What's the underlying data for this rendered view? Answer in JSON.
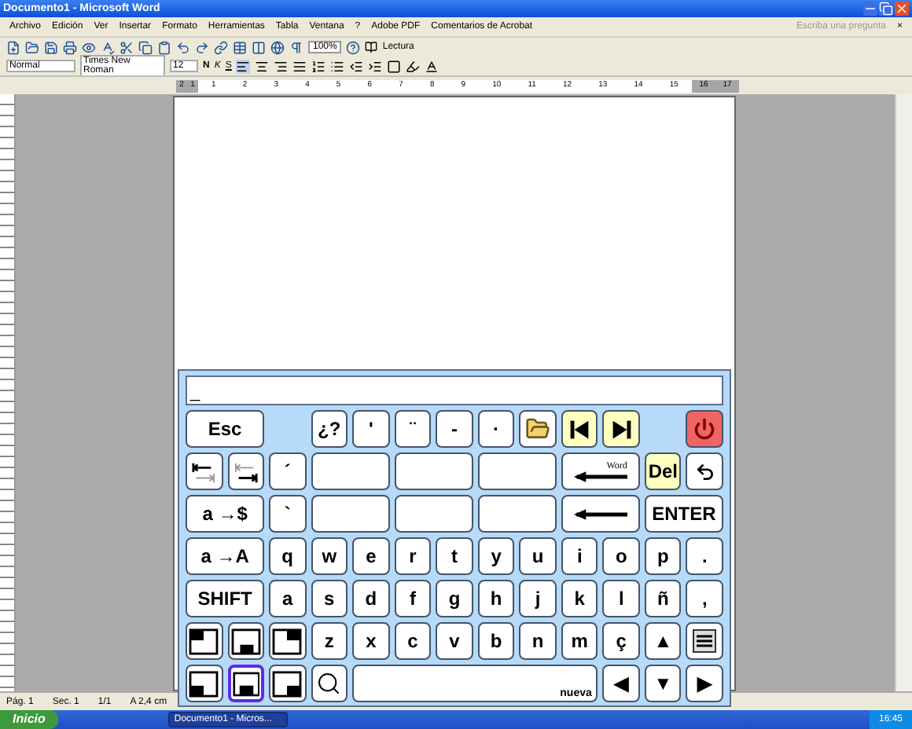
{
  "window": {
    "title": "Documento1 - Microsoft Word"
  },
  "menu": {
    "items": [
      "Archivo",
      "Edición",
      "Ver",
      "Insertar",
      "Formato",
      "Herramientas",
      "Tabla",
      "Ventana",
      "?",
      "Adobe PDF",
      "Comentarios de Acrobat"
    ],
    "help_placeholder": "Escriba una pregunta",
    "close": "×"
  },
  "toolbar": {
    "zoom": "100%",
    "reading": "Lectura"
  },
  "format_bar": {
    "style": "Normal",
    "font": "Times New Roman",
    "size": "12",
    "bold": "N",
    "italic": "K",
    "underline": "S"
  },
  "ruler": {
    "left_numbers": [
      "2",
      "1"
    ],
    "numbers": [
      "1",
      "2",
      "3",
      "4",
      "5",
      "6",
      "7",
      "8",
      "9",
      "10",
      "11",
      "12",
      "13",
      "14",
      "15"
    ],
    "right_numbers": [
      "16",
      "17"
    ]
  },
  "status_bar": [
    "Pág. 1",
    "Sec. 1",
    "1/1",
    "A 2,4 cm"
  ],
  "taskbar": {
    "start": "Inicio",
    "task": "Documento1 - Micros...",
    "clock": "16:45"
  },
  "keyboard": {
    "input": "_",
    "rows": [
      {
        "keys": [
          {
            "kind": "text",
            "label": "Esc",
            "color": "#ffffff",
            "selected": false
          },
          {
            "kind": "gap"
          },
          {
            "kind": "text",
            "label": "¿?",
            "color": "#ffffff",
            "selected": false
          },
          {
            "kind": "text",
            "label": "'",
            "color": "#ffffff",
            "selected": false
          },
          {
            "kind": "text",
            "label": "¨",
            "color": "#ffffff",
            "selected": false
          },
          {
            "kind": "text",
            "label": "-",
            "color": "#ffffff",
            "selected": false
          },
          {
            "kind": "text",
            "label": "·",
            "color": "#ffffff",
            "selected": false
          },
          {
            "kind": "open",
            "color": "#ffffff",
            "selected": false
          },
          {
            "kind": "first",
            "color": "#ffffc0",
            "selected": false
          },
          {
            "kind": "last",
            "color": "#ffffc0",
            "selected": false
          },
          {
            "kind": "gap"
          },
          {
            "kind": "power",
            "color": "#f06464",
            "selected": false
          }
        ]
      },
      {
        "keys": [
          {
            "kind": "tab-back",
            "color": "#ffffff",
            "selected": false
          },
          {
            "kind": "tab-fwd",
            "color": "#ffffff",
            "selected": false
          },
          {
            "kind": "text",
            "label": "´",
            "color": "#ffffff",
            "selected": false
          },
          {
            "kind": "blank",
            "color": "#ffffff",
            "selected": false
          },
          {
            "kind": "blank",
            "color": "#ffffff",
            "selected": false
          },
          {
            "kind": "blank",
            "color": "#ffffff",
            "selected": false
          },
          {
            "kind": "word-back",
            "label": "Word",
            "color": "#ffffff",
            "selected": false
          },
          {
            "kind": "text",
            "label": "Del",
            "color": "#ffffc0",
            "selected": false
          },
          {
            "kind": "undo",
            "color": "#ffffff",
            "selected": false
          }
        ]
      },
      {
        "keys": [
          {
            "kind": "text",
            "label": "a →$",
            "color": "#ffffff",
            "selected": false
          },
          {
            "kind": "text",
            "label": "`",
            "color": "#ffffff",
            "selected": false
          },
          {
            "kind": "blank",
            "color": "#ffffff",
            "selected": false
          },
          {
            "kind": "blank",
            "color": "#ffffff",
            "selected": false
          },
          {
            "kind": "blank",
            "color": "#ffffff",
            "selected": false
          },
          {
            "kind": "back",
            "color": "#ffffff",
            "selected": false
          },
          {
            "kind": "text",
            "label": "ENTER",
            "color": "#ffffff",
            "selected": false
          }
        ]
      },
      {
        "keys": [
          {
            "kind": "text",
            "label": "a →A",
            "color": "#ffffff",
            "selected": false
          },
          {
            "kind": "text",
            "label": "q",
            "color": "#ffffff",
            "selected": false
          },
          {
            "kind": "text",
            "label": "w",
            "color": "#ffffff",
            "selected": false
          },
          {
            "kind": "text",
            "label": "e",
            "color": "#ffffff",
            "selected": false
          },
          {
            "kind": "text",
            "label": "r",
            "color": "#ffffff",
            "selected": false
          },
          {
            "kind": "text",
            "label": "t",
            "color": "#ffffff",
            "selected": false
          },
          {
            "kind": "text",
            "label": "y",
            "color": "#ffffff",
            "selected": false
          },
          {
            "kind": "text",
            "label": "u",
            "color": "#ffffff",
            "selected": false
          },
          {
            "kind": "text",
            "label": "i",
            "color": "#ffffff",
            "selected": false
          },
          {
            "kind": "text",
            "label": "o",
            "color": "#ffffff",
            "selected": false
          },
          {
            "kind": "text",
            "label": "p",
            "color": "#ffffff",
            "selected": false
          },
          {
            "kind": "text",
            "label": ".",
            "color": "#ffffff",
            "selected": false
          }
        ]
      },
      {
        "keys": [
          {
            "kind": "text",
            "label": "SHIFT",
            "color": "#ffffff",
            "selected": false
          },
          {
            "kind": "text",
            "label": "a",
            "color": "#ffffff",
            "selected": false
          },
          {
            "kind": "text",
            "label": "s",
            "color": "#ffffff",
            "selected": false
          },
          {
            "kind": "text",
            "label": "d",
            "color": "#ffffff",
            "selected": false
          },
          {
            "kind": "text",
            "label": "f",
            "color": "#ffffff",
            "selected": false
          },
          {
            "kind": "text",
            "label": "g",
            "color": "#ffffff",
            "selected": false
          },
          {
            "kind": "text",
            "label": "h",
            "color": "#ffffff",
            "selected": false
          },
          {
            "kind": "text",
            "label": "j",
            "color": "#ffffff",
            "selected": false
          },
          {
            "kind": "text",
            "label": "k",
            "color": "#ffffff",
            "selected": false
          },
          {
            "kind": "text",
            "label": "l",
            "color": "#ffffff",
            "selected": false
          },
          {
            "kind": "text",
            "label": "ñ",
            "color": "#ffffff",
            "selected": false
          },
          {
            "kind": "text",
            "label": ",",
            "color": "#ffffff",
            "selected": false
          }
        ]
      },
      {
        "keys": [
          {
            "kind": "dock-top-left",
            "color": "#ffffff",
            "selected": false
          },
          {
            "kind": "dock-bottom-small",
            "color": "#ffffff",
            "selected": false
          },
          {
            "kind": "dock-top-right",
            "color": "#ffffff",
            "selected": false
          },
          {
            "kind": "text",
            "label": "z",
            "color": "#ffffff",
            "selected": false
          },
          {
            "kind": "text",
            "label": "x",
            "color": "#ffffff",
            "selected": false
          },
          {
            "kind": "text",
            "label": "c",
            "color": "#ffffff",
            "selected": false
          },
          {
            "kind": "text",
            "label": "v",
            "color": "#ffffff",
            "selected": false
          },
          {
            "kind": "text",
            "label": "b",
            "color": "#ffffff",
            "selected": false
          },
          {
            "kind": "text",
            "label": "n",
            "color": "#ffffff",
            "selected": false
          },
          {
            "kind": "text",
            "label": "m",
            "color": "#ffffff",
            "selected": false
          },
          {
            "kind": "text",
            "label": "ç",
            "color": "#ffffff",
            "selected": false
          },
          {
            "kind": "text",
            "label": "▲",
            "color": "#ffffff",
            "selected": false
          },
          {
            "kind": "menu",
            "color": "#ffffff",
            "selected": false
          }
        ]
      },
      {
        "keys": [
          {
            "kind": "dock-bottom-left",
            "color": "#ffffff",
            "selected": false
          },
          {
            "kind": "dock-bottom",
            "color": "#ffffff",
            "selected": true
          },
          {
            "kind": "dock-bottom-right",
            "color": "#ffffff",
            "selected": false
          },
          {
            "kind": "search",
            "color": "#ffffff",
            "selected": false
          },
          {
            "kind": "space",
            "label": "nueva",
            "color": "#ffffff",
            "selected": false
          },
          {
            "kind": "text",
            "label": "◀",
            "color": "#ffffff",
            "selected": false
          },
          {
            "kind": "text",
            "label": "▼",
            "color": "#ffffff",
            "selected": false
          },
          {
            "kind": "text",
            "label": "▶",
            "color": "#ffffff",
            "selected": false
          }
        ]
      }
    ]
  }
}
